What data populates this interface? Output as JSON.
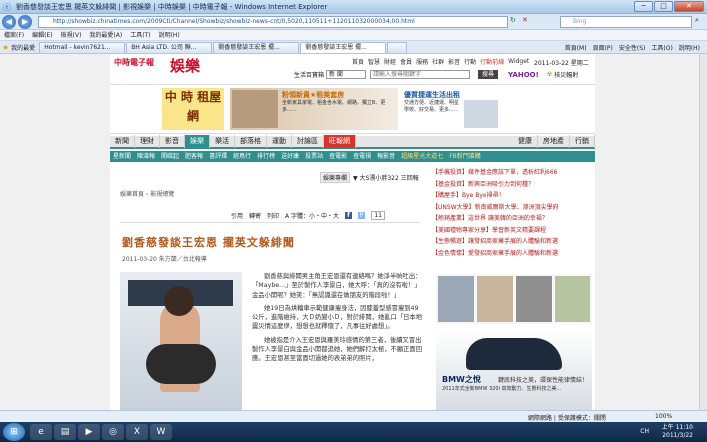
{
  "window": {
    "title": "劉香慈發談王宏恩 擺英文躲緋聞 | 影視娛樂 | 中時娛樂 | 中時電子報 - Windows Internet Explorer",
    "url": "http://showbiz.chinatimes.com/2009Cti/Channel/Showbiz/showbiz-news-cnt/0,5020,110511+112011032000034,00.html",
    "search_engine": "Bing",
    "buttons": {
      "back": "◀",
      "forward": "▶",
      "refresh": "↻",
      "stop": "✕",
      "min": "─",
      "max": "□",
      "close": "✕"
    }
  },
  "menu": [
    "檔案(F)",
    "編輯(E)",
    "檢視(V)",
    "我的最愛(A)",
    "工具(T)",
    "說明(H)"
  ],
  "favorites": {
    "label": "我的最愛",
    "tabs": [
      "Hotmail - kevin7621...",
      "BH Asia LTD. 公司 聯...",
      "劉香慈發談王宏恩 擺...",
      "劉香慈發談王宏恩 擺...",
      ""
    ],
    "tools": [
      "首頁(M)",
      "頁面(P)",
      "安全性(S)",
      "工具(O)",
      "說明(H)"
    ]
  },
  "site": {
    "logo": "中時電子報",
    "section_logo": "娛樂",
    "top_links": [
      "首頁",
      "智慧",
      "財經",
      "會員",
      "服務",
      "社群",
      "影音",
      "行動",
      "行動前線",
      "Widget"
    ],
    "date": "2011-03-22 星期二",
    "search_label": "生活百寶箱",
    "search_scope": "新 聞",
    "search_placeholder": "請輸入搜尋關鍵字",
    "search_button": "搜尋",
    "yahoo": "YAHOO!",
    "radiation": "核災輻射"
  },
  "banner": {
    "rent": "中 時 租屋網",
    "ad1_title": "粉領新貴★租美套房",
    "ad1_desc": "全新家具家電、租金含水電、網路、獨立B、更多......",
    "ad2_title": "優質捷運生活出租",
    "ad2_desc": "交通方便、近捷運、明星學校、好交易、更多......"
  },
  "nav_primary": [
    "新聞",
    "理財",
    "影音",
    "娛樂",
    "樂活",
    "部落格",
    "運動",
    "討論區",
    "旺報網",
    "",
    "健康",
    "房地產",
    "行銷"
  ],
  "nav_secondary": [
    "星新聞",
    "陳濤報",
    "開碳起",
    "肥客報",
    "書評擇",
    "經鳥行",
    "排行榜",
    "送好康",
    "投票站",
    "查電影",
    "查電視",
    "報影音",
    "超級星光大道七",
    "FB粉門搶購"
  ],
  "ticker": {
    "label": "娛樂專欄",
    "text": "▼ 大S漂小胖322 三回報"
  },
  "breadcrumb": "娛樂首頁 › 影視總覽",
  "tools": [
    "引用",
    "轉寄",
    "列印",
    "A 字體：小・中・大"
  ],
  "like_count": "11",
  "headline": "劉香慈發談王宏恩 擺英文躲緋聞",
  "byline": "2011-03-20 朱方蘭／台北報導",
  "article": [
    "劉香慈與緋聞男主角王宏恩還有連絡嗎？她淨半晌吐出：「Maybe...」至於製作人李景白，她大呼：「真的沒有啦！」金品小開呢？她笑：「無認識還在做朋友的階段啦！」",
    "她19日為烘輪車示範健康瘦身法，因膝蓋型感冒瘦到49公斤，進階維持，大Ｄ奶變小Ｄ，對於緋聞，她亂口「日本地震災情這麼慘，想想也就釋懷了，凡事往好處想」。",
    "她被指是介入王宏恩與羅美玲感情的第三者，後續又冒出製作人李景白與金品小開都追她，她們解打太極，不願正面回應。王宏恩甚至當面切過她的表弟弟的照片，"
  ],
  "right_list": [
    "【手機投資】幾件基金應該下單，透析紅利666",
    "【基金投資】新興亞洲吸引力到何種？",
    "【購屋手】Bye Bye掃帚！",
    "【UNSW大學】新南威爾斯大學．澳洲頂尖學府",
    "【熱銷產業】這世界 讓美韓的亞洲的幸福？",
    "【美國禮物專家分享】學習新英文精要課程",
    "【生態暢遊】讓發招商家擁手展的人體驗和新選",
    "【金色情懷】愛發招商家擁手展的人體驗和新選"
  ],
  "ad_bmw": {
    "title": "BMW之悅",
    "desc": "2011年式全新BMW 320i 高效動力．生態科技之美...",
    "cta": "鍵底科技之美，環保性能律情結！"
  },
  "status": {
    "left": "",
    "right": "網際網路 | 受保護模式：關閉",
    "zoom": "100%"
  },
  "taskbar": {
    "clock_time": "上午 11:10",
    "clock_date": "2011/3/22",
    "ime": "CH"
  }
}
